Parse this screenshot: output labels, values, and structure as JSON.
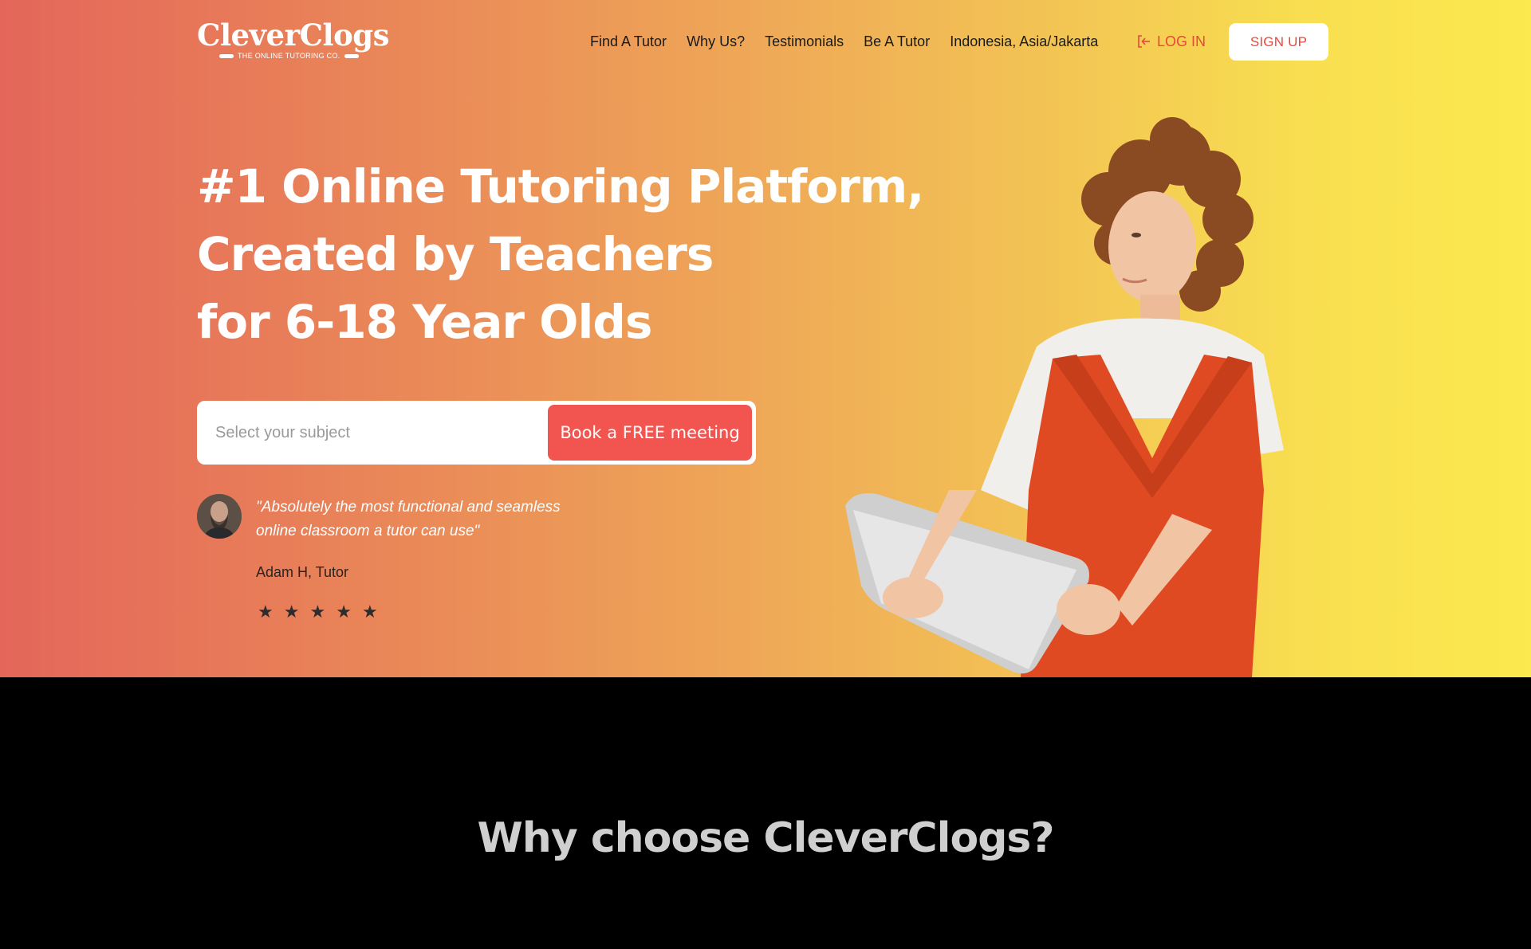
{
  "brand": {
    "name": "CleverClogs",
    "tagline": "THE ONLINE TUTORING CO."
  },
  "nav": {
    "items": [
      {
        "label": "Find A Tutor"
      },
      {
        "label": "Why Us?"
      },
      {
        "label": "Testimonials"
      },
      {
        "label": "Be A Tutor"
      },
      {
        "label": "Indonesia, Asia/Jakarta"
      }
    ],
    "login_label": "LOG IN",
    "login_icon": "login-arrow-icon",
    "signup_label": "SIGN UP"
  },
  "hero": {
    "headline": [
      "#1 Online Tutoring Platform,",
      "Created by Teachers",
      "for 6-18 Year Olds"
    ],
    "subject_placeholder": "Select your subject",
    "cta_label": "Book a FREE meeting"
  },
  "testimonial": {
    "quote_line1": "\"Absolutely the most functional and seamless",
    "quote_line2": "online classroom a tutor can use\"",
    "author": "Adam H, Tutor",
    "rating": 5,
    "star_glyph": "★"
  },
  "why": {
    "title": "Why choose CleverClogs?"
  },
  "colors": {
    "accent": "#f25550",
    "gradient_start": "#e4665a",
    "gradient_end": "#fbe94e",
    "text_dark": "#1a1a1a"
  }
}
